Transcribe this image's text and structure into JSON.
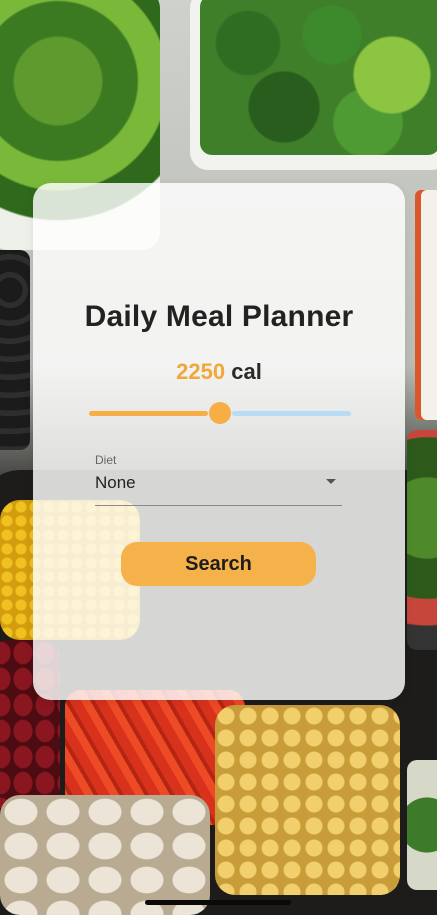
{
  "app": {
    "title": "Daily Meal Planner"
  },
  "calories": {
    "value": "2250",
    "unit": "cal",
    "slider_fraction": 0.5
  },
  "diet": {
    "label": "Diet",
    "selected": "None",
    "icon": "chevron-down-icon"
  },
  "actions": {
    "search_label": "Search"
  },
  "colors": {
    "accent": "#f6ae45",
    "slider_inactive": "#b8dcf3"
  }
}
